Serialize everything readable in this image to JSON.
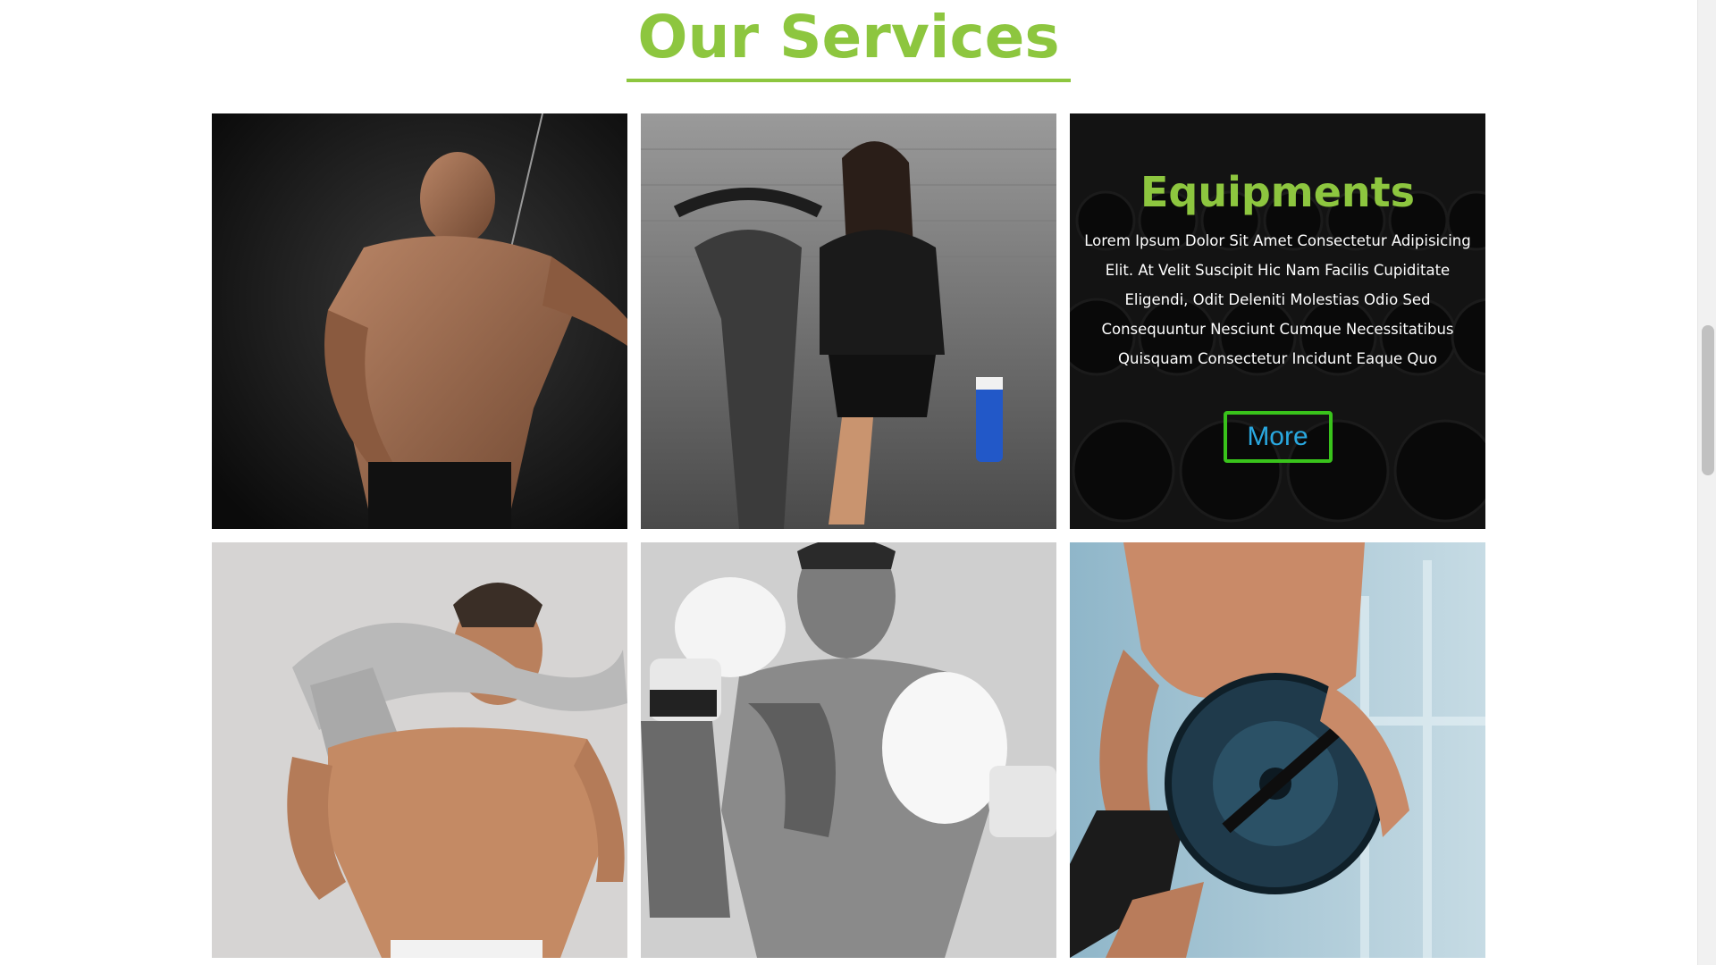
{
  "section": {
    "title": "Our Services"
  },
  "featured": {
    "title": "Equipments",
    "description": "Lorem Ipsum Dolor Sit Amet Consectetur Adipisicing Elit. At Velit Suscipit Hic Nam Facilis Cupiditate Eligendi, Odit Deleniti Molestias Odio Sed Consequuntur Nesciunt Cumque Necessitatibus Quisquam Consectetur Incidunt Eaque Quo",
    "button_label": "More"
  },
  "colors": {
    "accent": "#8dc63f",
    "button_border": "#39c31b",
    "button_text": "#29a8e0"
  },
  "scrollbar": {
    "position_fraction": 0.34
  }
}
